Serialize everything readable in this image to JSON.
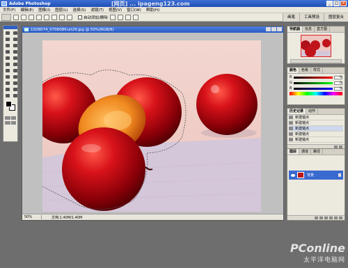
{
  "window": {
    "title": "Adobe Photoshop",
    "watermark": "[网页] ... ipageng123.com",
    "buttons": [
      "_",
      "□",
      "×"
    ]
  },
  "menu": [
    "文件(F)",
    "编辑(E)",
    "图像(I)",
    "图层(L)",
    "选择(S)",
    "滤镜(T)",
    "视图(V)",
    "窗口(W)",
    "帮助(H)"
  ],
  "options_bar": {
    "checkbox_label": "自动添加/删除",
    "right_tabs": [
      "画笔",
      "工具预设",
      "图层复合"
    ]
  },
  "document": {
    "title": "1028074_070608fruit29.jpg @ 50%(RGB/8)",
    "zoom": "50%",
    "doc_size": "文档:1.40M/1.40M"
  },
  "panels": {
    "navigator_tabs": [
      "导航器",
      "信息",
      "直方图"
    ],
    "color_tabs": [
      "颜色",
      "色板",
      "样式"
    ],
    "color_channels": [
      {
        "label": "R",
        "value": "0"
      },
      {
        "label": "G",
        "value": "0"
      },
      {
        "label": "B",
        "value": "0"
      }
    ],
    "history_tabs": [
      "历史记录",
      "动作"
    ],
    "history_items": [
      "新建锚点",
      "新建锚点",
      "新建锚点",
      "新建锚点",
      "新建锚点",
      "新建锚点"
    ],
    "layers_tabs": [
      "图层",
      "通道",
      "路径"
    ],
    "layer_name": "背景"
  },
  "logo": {
    "brand": "PConline",
    "sub": "太平洋电脑网"
  },
  "colors": {
    "titlebar": "#2a5bc0",
    "plum": "#c0141a",
    "peach_flesh": "#f0a030",
    "background_pink": "#f1cfc9",
    "tablecloth": "#d7c9dc"
  }
}
